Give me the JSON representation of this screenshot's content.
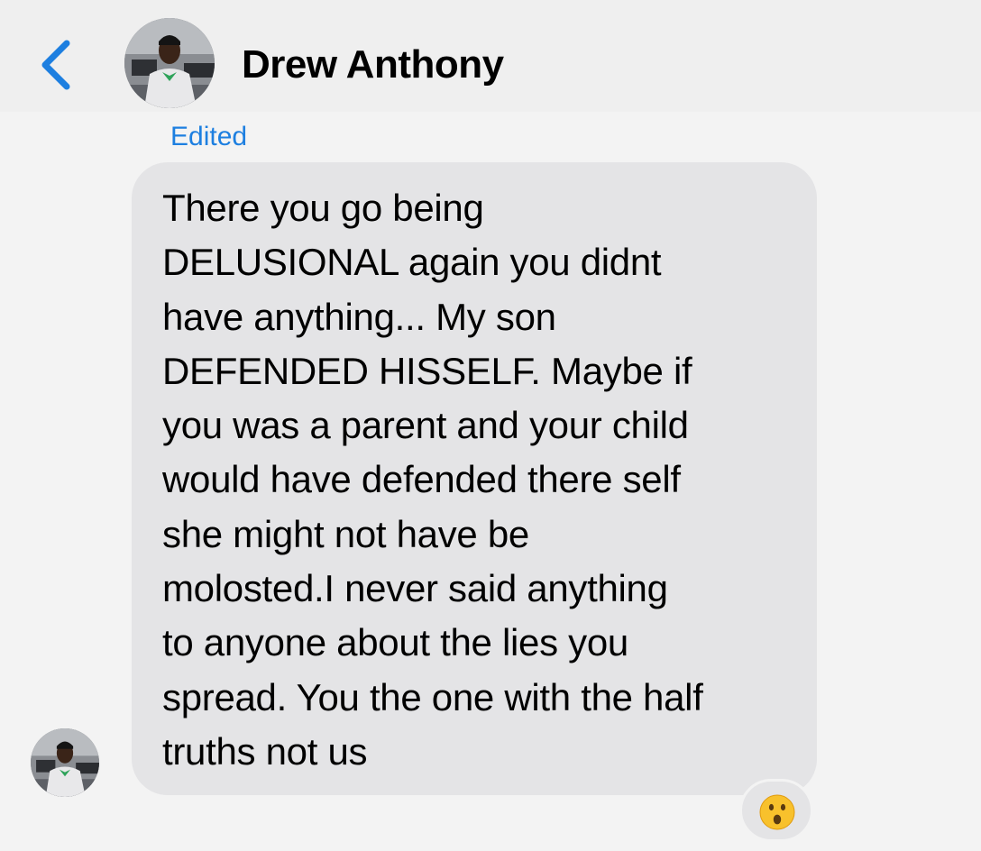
{
  "header": {
    "back_icon": "chevron-left-icon",
    "contact_name": "Drew Anthony"
  },
  "message": {
    "edited_label": "Edited",
    "lines": [
      "There you go being",
      "DELUSIONAL again you didnt",
      "have anything... My son",
      "DEFENDED HISSELF. Maybe if",
      "you was a parent and your child",
      "would have defended there self",
      "she might not have be",
      "molosted.I never said anything",
      "to anyone about the lies you",
      "spread. You the one with the half",
      "truths not us"
    ],
    "reaction": "surprised-face-emoji"
  },
  "colors": {
    "accent": "#1d7fe0",
    "bubble": "#e4e4e6",
    "background": "#f3f3f3",
    "header": "#efefef"
  }
}
